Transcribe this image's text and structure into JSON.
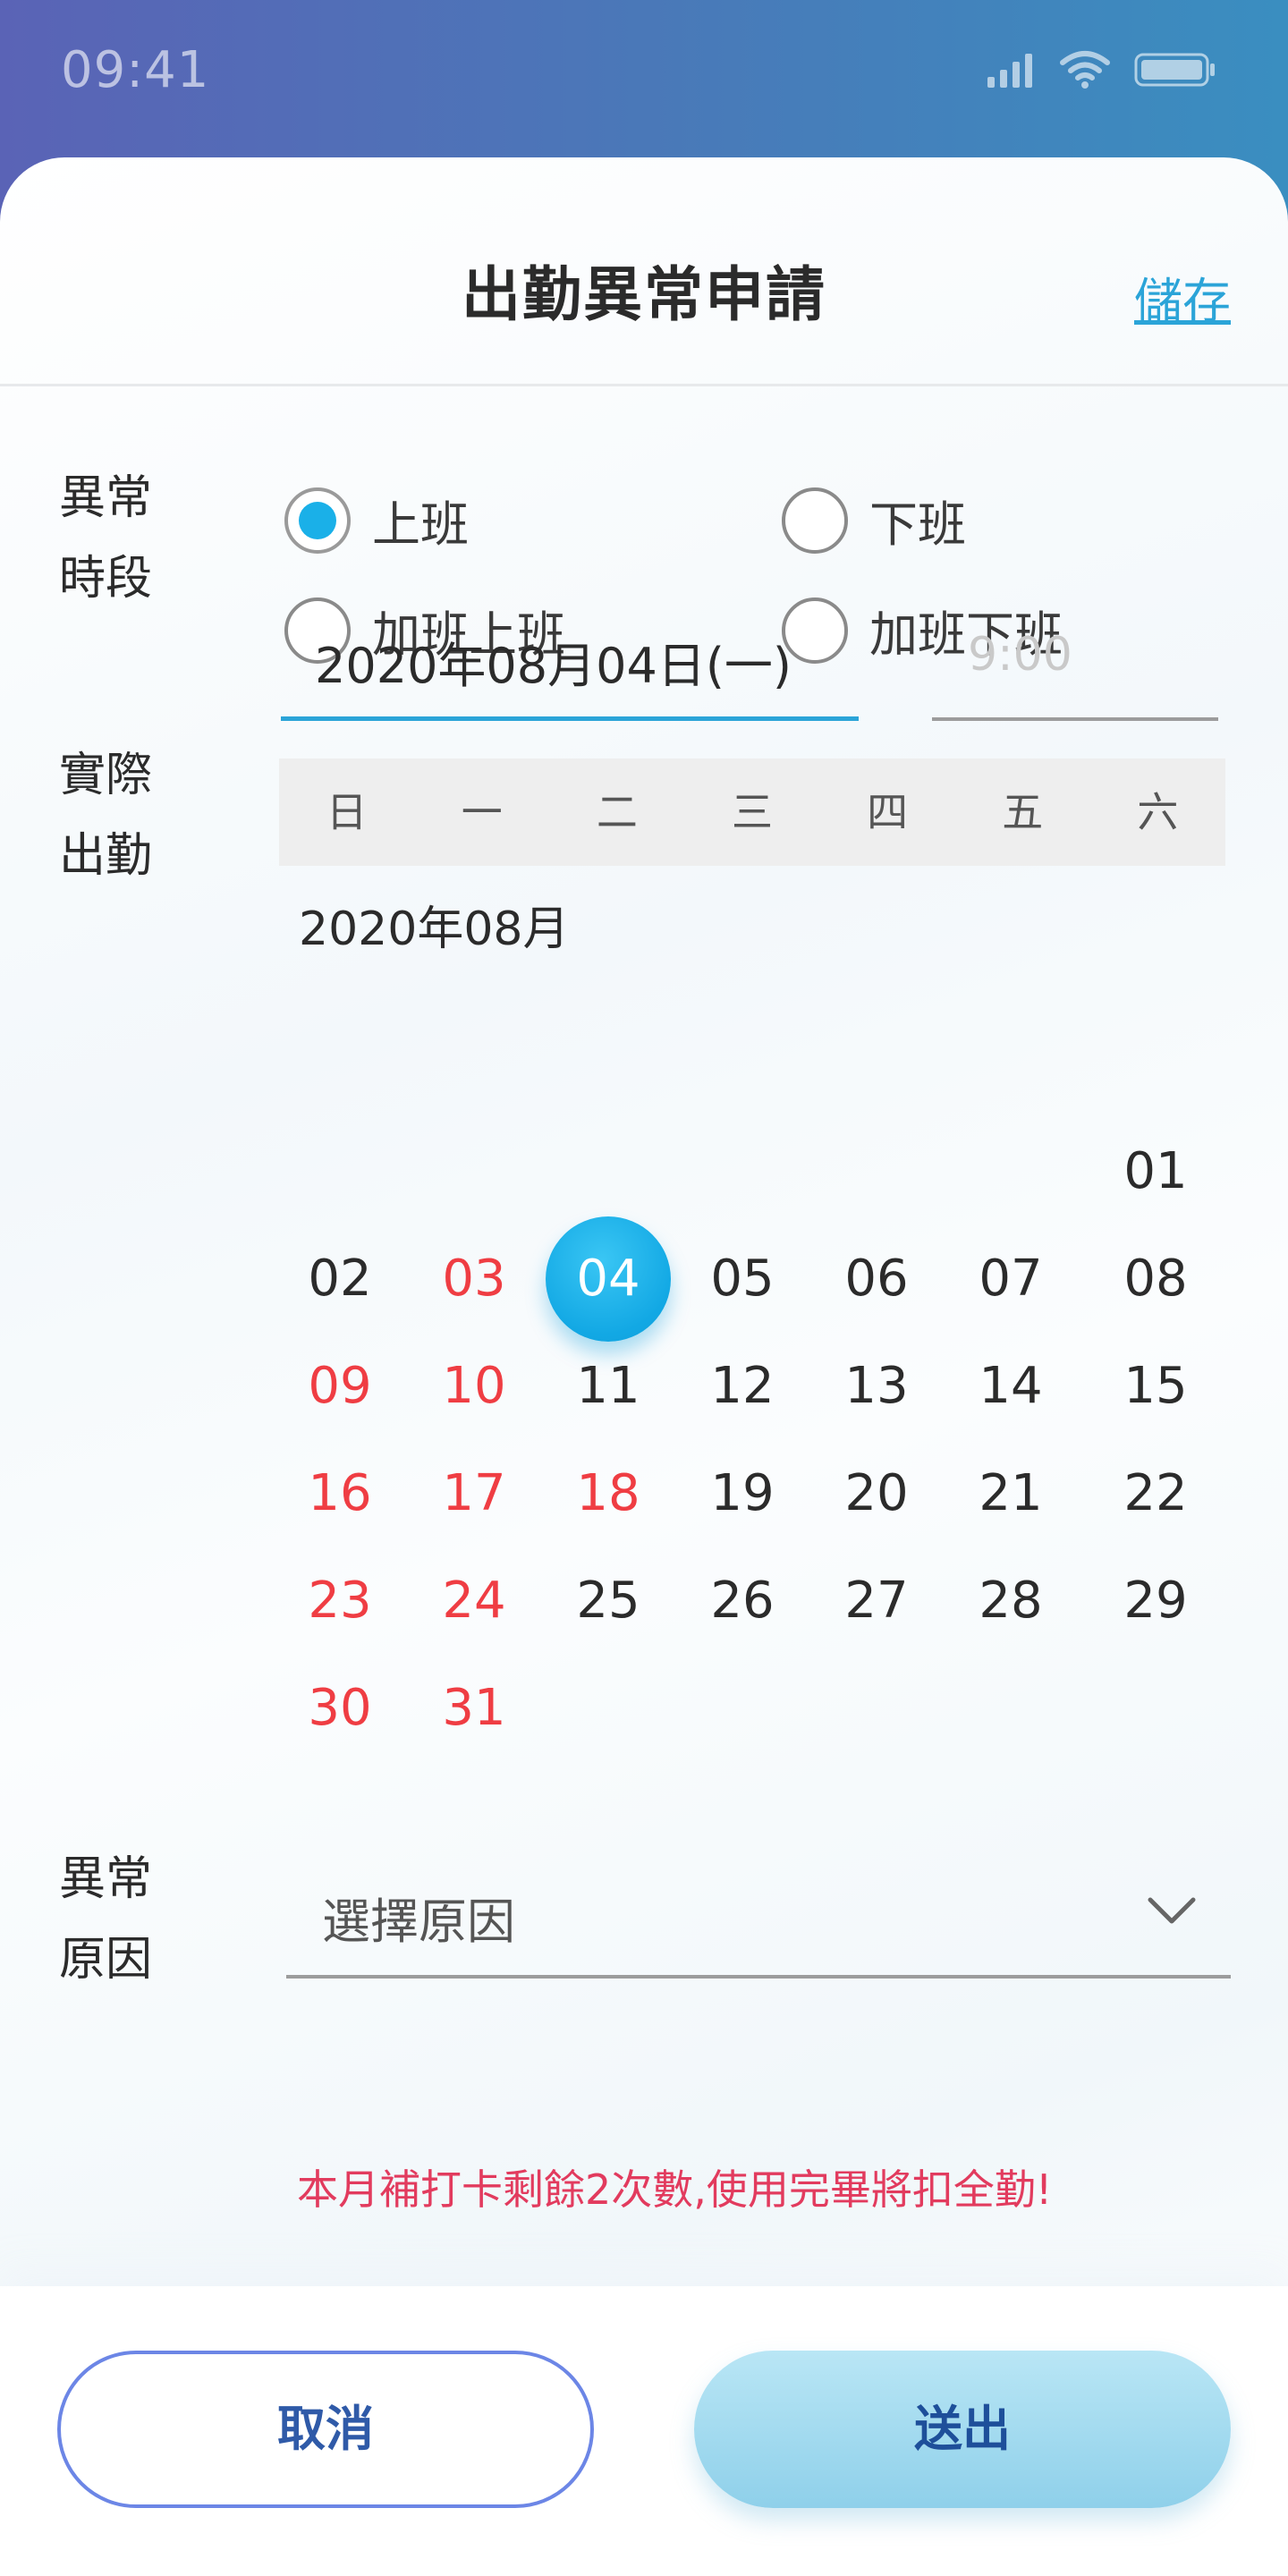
{
  "status_bar": {
    "time": "09:41"
  },
  "header": {
    "title": "出勤異常申請",
    "save_label": "儲存"
  },
  "period": {
    "label_line1": "異常",
    "label_line2": "時段",
    "options": [
      {
        "label": "上班",
        "checked": true
      },
      {
        "label": "下班",
        "checked": false
      },
      {
        "label": "加班上班",
        "checked": false
      },
      {
        "label": "加班下班",
        "checked": false
      }
    ]
  },
  "actual": {
    "label_line1": "實際",
    "label_line2": "出勤",
    "date_value": "2020年08月04日(一)",
    "time_placeholder": "9:00"
  },
  "calendar": {
    "weekdays": [
      "日",
      "一",
      "二",
      "三",
      "四",
      "五",
      "六"
    ],
    "month_label": "2020年08月",
    "first_weekday": 6,
    "days": [
      "01",
      "02",
      "03",
      "04",
      "05",
      "06",
      "07",
      "08",
      "09",
      "10",
      "11",
      "12",
      "13",
      "14",
      "15",
      "16",
      "17",
      "18",
      "19",
      "20",
      "21",
      "22",
      "23",
      "24",
      "25",
      "26",
      "27",
      "28",
      "29",
      "30",
      "31"
    ],
    "selected": "04",
    "red_days": [
      "03",
      "09",
      "10",
      "16",
      "17",
      "18",
      "23",
      "24",
      "30",
      "31"
    ],
    "colors": {
      "weekend": "#ef3d43",
      "selected": "#1ab0e8"
    }
  },
  "reason": {
    "label_line1": "異常",
    "label_line2": "原因",
    "placeholder": "選擇原因"
  },
  "warning": "本月補打卡剩餘2次數,使用完畢將扣全勤!",
  "buttons": {
    "cancel": "取消",
    "submit": "送出"
  }
}
